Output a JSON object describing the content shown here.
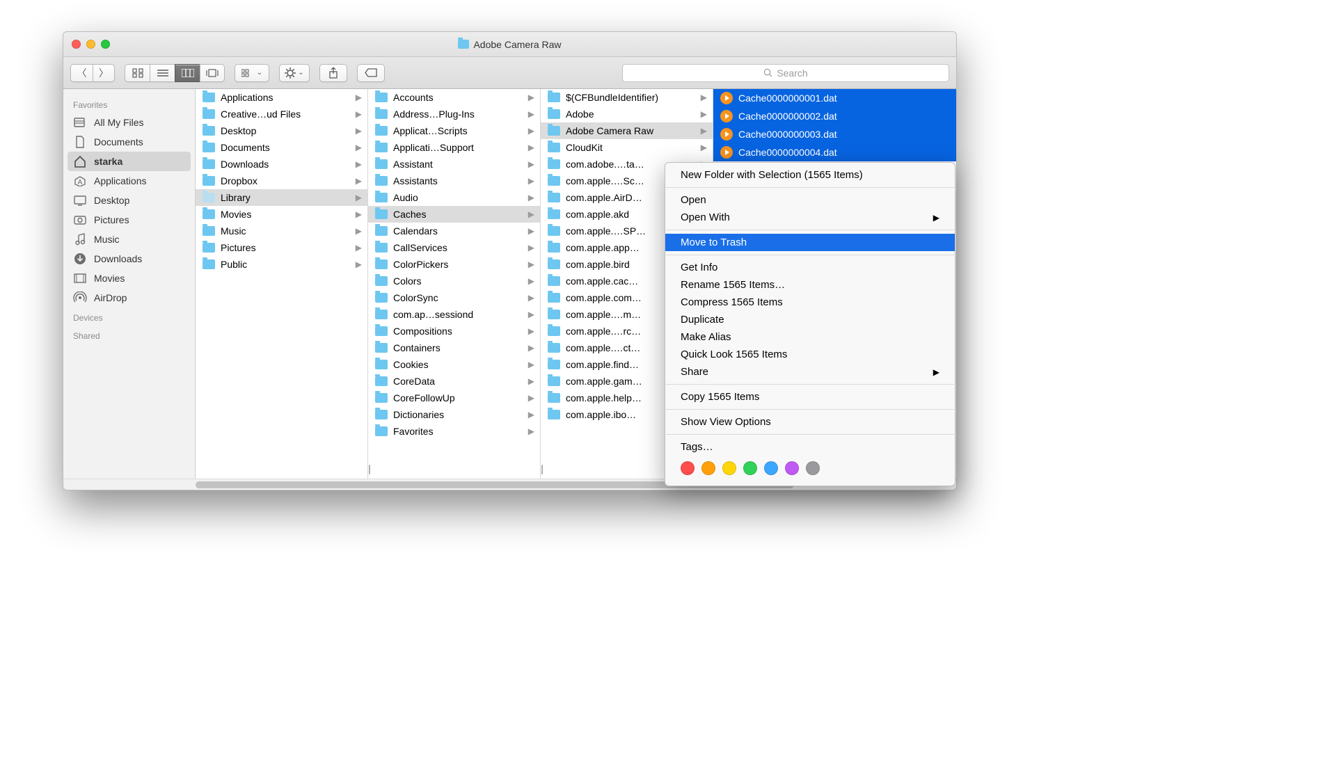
{
  "window": {
    "title": "Adobe Camera Raw"
  },
  "search": {
    "placeholder": "Search"
  },
  "sidebar": {
    "sections": [
      {
        "header": "Favorites",
        "items": [
          {
            "label": "All My Files",
            "icon": "all-files"
          },
          {
            "label": "Documents",
            "icon": "document"
          },
          {
            "label": "starka",
            "icon": "home",
            "selected": true
          },
          {
            "label": "Applications",
            "icon": "applications"
          },
          {
            "label": "Desktop",
            "icon": "desktop"
          },
          {
            "label": "Pictures",
            "icon": "pictures"
          },
          {
            "label": "Music",
            "icon": "music"
          },
          {
            "label": "Downloads",
            "icon": "downloads"
          },
          {
            "label": "Movies",
            "icon": "movies"
          },
          {
            "label": "AirDrop",
            "icon": "airdrop"
          }
        ]
      },
      {
        "header": "Devices",
        "items": []
      },
      {
        "header": "Shared",
        "items": []
      }
    ]
  },
  "columns": [
    {
      "items": [
        {
          "label": "Applications"
        },
        {
          "label": "Creative…ud Files"
        },
        {
          "label": "Desktop"
        },
        {
          "label": "Documents"
        },
        {
          "label": "Downloads"
        },
        {
          "label": "Dropbox"
        },
        {
          "label": "Library",
          "selected": true,
          "dim": true
        },
        {
          "label": "Movies"
        },
        {
          "label": "Music"
        },
        {
          "label": "Pictures"
        },
        {
          "label": "Public"
        }
      ]
    },
    {
      "items": [
        {
          "label": "Accounts"
        },
        {
          "label": "Address…Plug-Ins"
        },
        {
          "label": "Applicat…Scripts"
        },
        {
          "label": "Applicati…Support"
        },
        {
          "label": "Assistant"
        },
        {
          "label": "Assistants"
        },
        {
          "label": "Audio"
        },
        {
          "label": "Caches",
          "selected": true
        },
        {
          "label": "Calendars"
        },
        {
          "label": "CallServices"
        },
        {
          "label": "ColorPickers"
        },
        {
          "label": "Colors"
        },
        {
          "label": "ColorSync"
        },
        {
          "label": "com.ap…sessiond"
        },
        {
          "label": "Compositions"
        },
        {
          "label": "Containers"
        },
        {
          "label": "Cookies"
        },
        {
          "label": "CoreData"
        },
        {
          "label": "CoreFollowUp"
        },
        {
          "label": "Dictionaries"
        },
        {
          "label": "Favorites"
        }
      ]
    },
    {
      "items": [
        {
          "label": "$(CFBundleIdentifier)"
        },
        {
          "label": "Adobe"
        },
        {
          "label": "Adobe Camera Raw",
          "selected": true
        },
        {
          "label": "CloudKit"
        },
        {
          "label": "com.adobe.…ta…"
        },
        {
          "label": "com.apple.…Sc…"
        },
        {
          "label": "com.apple.AirD…"
        },
        {
          "label": "com.apple.akd"
        },
        {
          "label": "com.apple.…SP…"
        },
        {
          "label": "com.apple.app…"
        },
        {
          "label": "com.apple.bird"
        },
        {
          "label": "com.apple.cac…"
        },
        {
          "label": "com.apple.com…"
        },
        {
          "label": "com.apple.…m…"
        },
        {
          "label": "com.apple.…rc…"
        },
        {
          "label": "com.apple.…ct…"
        },
        {
          "label": "com.apple.find…"
        },
        {
          "label": "com.apple.gam…"
        },
        {
          "label": "com.apple.help…"
        },
        {
          "label": "com.apple.ibo…"
        }
      ]
    },
    {
      "items": [
        {
          "label": "Cache0000000001.dat",
          "file": true,
          "hl": true
        },
        {
          "label": "Cache0000000002.dat",
          "file": true,
          "hl": true
        },
        {
          "label": "Cache0000000003.dat",
          "file": true,
          "hl": true
        },
        {
          "label": "Cache0000000004.dat",
          "file": true,
          "hl": true
        }
      ]
    }
  ],
  "contextMenu": {
    "groups": [
      [
        {
          "label": "New Folder with Selection (1565 Items)"
        }
      ],
      [
        {
          "label": "Open"
        },
        {
          "label": "Open With",
          "submenu": true
        }
      ],
      [
        {
          "label": "Move to Trash",
          "highlight": true
        }
      ],
      [
        {
          "label": "Get Info"
        },
        {
          "label": "Rename 1565 Items…"
        },
        {
          "label": "Compress 1565 Items"
        },
        {
          "label": "Duplicate"
        },
        {
          "label": "Make Alias"
        },
        {
          "label": "Quick Look 1565 Items"
        },
        {
          "label": "Share",
          "submenu": true
        }
      ],
      [
        {
          "label": "Copy 1565 Items"
        }
      ],
      [
        {
          "label": "Show View Options"
        }
      ],
      [
        {
          "label": "Tags…"
        }
      ]
    ],
    "tagColors": [
      "#ff4d4d",
      "#ff9f0a",
      "#ffd60a",
      "#30d158",
      "#3ca7ff",
      "#bf5af2",
      "#9a9a9e"
    ]
  }
}
